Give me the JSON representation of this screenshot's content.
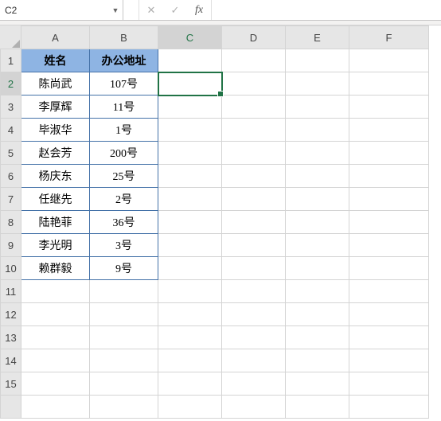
{
  "formula_bar": {
    "name_box": "C2",
    "formula": ""
  },
  "columns": [
    "A",
    "B",
    "C",
    "D",
    "E",
    "F"
  ],
  "row_count": 16,
  "active_cell": {
    "col": "C",
    "row": 2
  },
  "headers": {
    "A": "姓名",
    "B": "办公地址"
  },
  "data_region": {
    "rows_from": 2,
    "rows_to": 10,
    "cols": [
      "A",
      "B"
    ]
  },
  "rows": {
    "2": {
      "A": "陈尚武",
      "B": "107号"
    },
    "3": {
      "A": "李厚辉",
      "B": "11号"
    },
    "4": {
      "A": "毕淑华",
      "B": "1号"
    },
    "5": {
      "A": "赵会芳",
      "B": "200号"
    },
    "6": {
      "A": "杨庆东",
      "B": "25号"
    },
    "7": {
      "A": "任继先",
      "B": "2号"
    },
    "8": {
      "A": "陆艳菲",
      "B": "36号"
    },
    "9": {
      "A": "李光明",
      "B": "3号"
    },
    "10": {
      "A": "赖群毅",
      "B": "9号"
    }
  },
  "chart_data": {
    "type": "table",
    "title": "",
    "columns": [
      "姓名",
      "办公地址"
    ],
    "rows": [
      [
        "陈尚武",
        "107号"
      ],
      [
        "李厚辉",
        "11号"
      ],
      [
        "毕淑华",
        "1号"
      ],
      [
        "赵会芳",
        "200号"
      ],
      [
        "杨庆东",
        "25号"
      ],
      [
        "任继先",
        "2号"
      ],
      [
        "陆艳菲",
        "36号"
      ],
      [
        "李光明",
        "3号"
      ],
      [
        "赖群毅",
        "9号"
      ]
    ]
  }
}
